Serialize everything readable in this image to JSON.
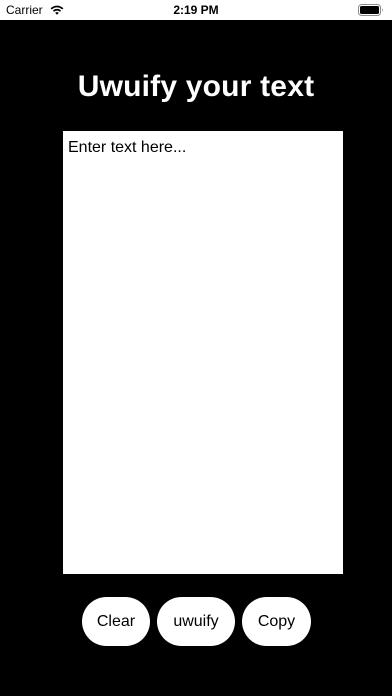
{
  "status_bar": {
    "carrier": "Carrier",
    "time": "2:19 PM",
    "icons": [
      "wifi-icon",
      "battery-icon"
    ]
  },
  "title": "Uwuify your text",
  "input": {
    "placeholder": "Enter text here...",
    "value": ""
  },
  "buttons": {
    "clear": "Clear",
    "uwuify": "uwuify",
    "copy": "Copy"
  },
  "colors": {
    "background": "#000000",
    "surface": "#ffffff",
    "text_light": "#ffffff",
    "text_dark": "#000000"
  }
}
